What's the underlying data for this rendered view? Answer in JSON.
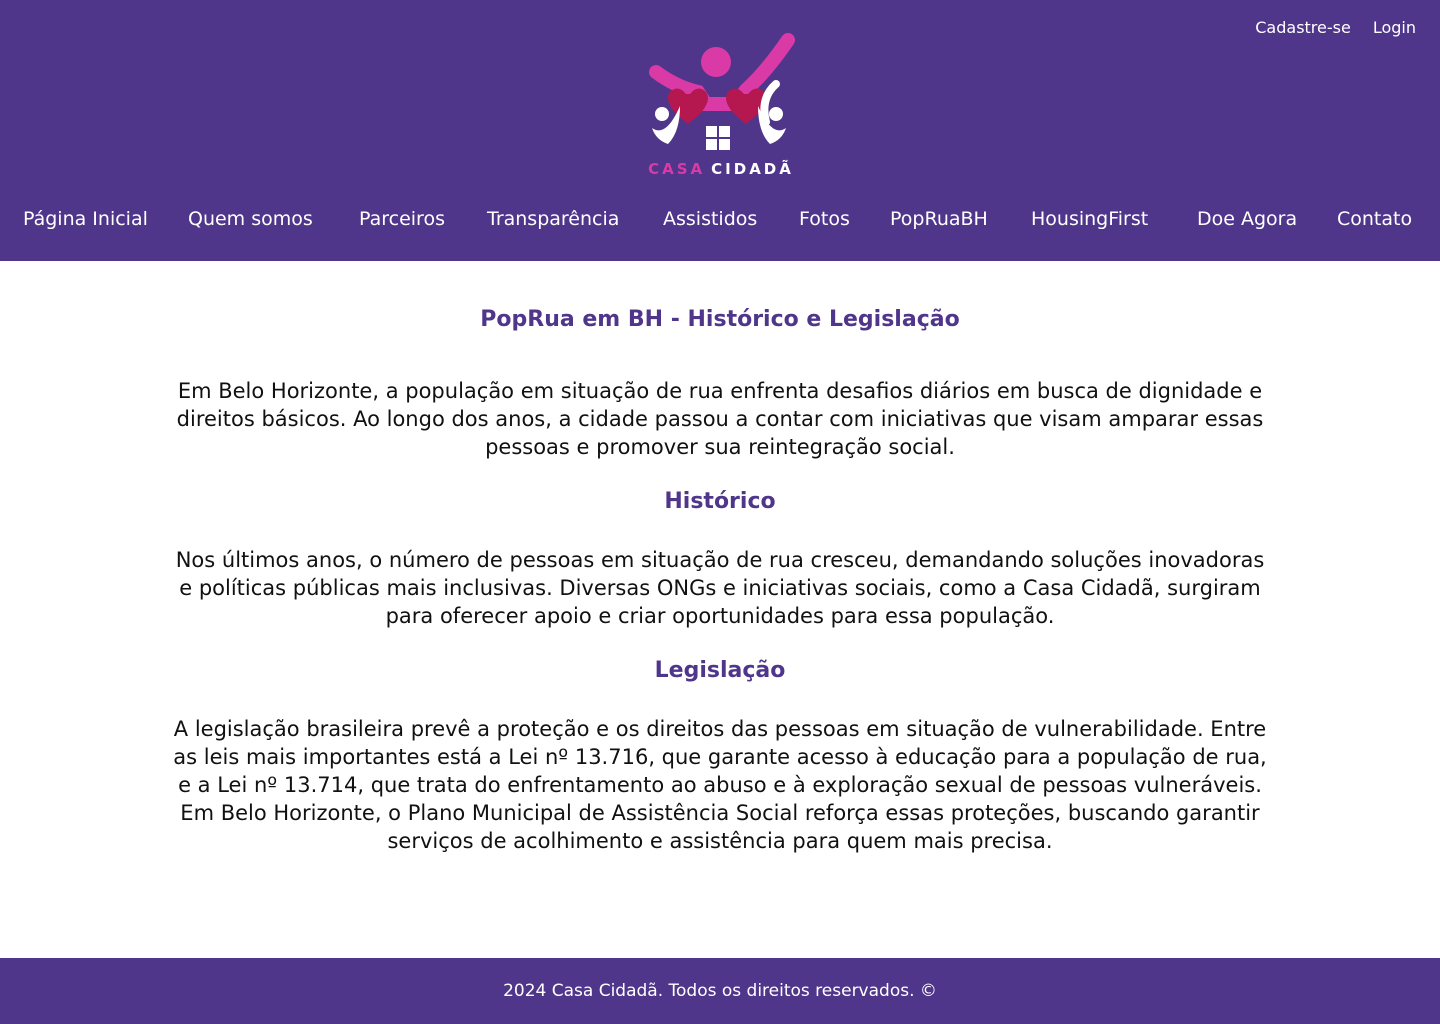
{
  "header": {
    "auth": {
      "signup_label": "Cadastre-se",
      "login_label": "Login"
    },
    "logo": {
      "word1": "CASA",
      "word2": "CIDADÃ"
    },
    "nav": [
      {
        "label": "Página Inicial"
      },
      {
        "label": "Quem somos"
      },
      {
        "label": "Parceiros"
      },
      {
        "label": "Transparência"
      },
      {
        "label": "Assistidos"
      },
      {
        "label": "Fotos"
      },
      {
        "label": "PopRuaBH"
      },
      {
        "label": "HousingFirst"
      },
      {
        "label": "Doe Agora"
      },
      {
        "label": "Contato"
      }
    ]
  },
  "main": {
    "title": "PopRua em BH - Histórico e Legislação",
    "intro": "Em Belo Horizonte, a população em situação de rua enfrenta desafios diários em busca de dignidade e direitos básicos. Ao longo dos anos, a cidade passou a contar com iniciativas que visam amparar essas pessoas e promover sua reintegração social.",
    "historico": {
      "title": "Histórico",
      "text": "Nos últimos anos, o número de pessoas em situação de rua cresceu, demandando soluções inovadoras e políticas públicas mais inclusivas. Diversas ONGs e iniciativas sociais, como a Casa Cidadã, surgiram para oferecer apoio e criar oportunidades para essa população."
    },
    "legislacao": {
      "title": "Legislação",
      "text": "A legislação brasileira prevê a proteção e os direitos das pessoas em situação de vulnerabilidade. Entre as leis mais importantes está a Lei nº 13.716, que garante acesso à educação para a população de rua, e a Lei nº 13.714, que trata do enfrentamento ao abuso e à exploração sexual de pessoas vulneráveis. Em Belo Horizonte, o Plano Municipal de Assistência Social reforça essas proteções, buscando garantir serviços de acolhimento e assistência para quem mais precisa."
    }
  },
  "footer": {
    "text": "2024 Casa Cidadã. Todos os direitos reservados. ©"
  },
  "colors": {
    "primary": "#4f368b",
    "accent": "#d93aa6",
    "heart": "#b5174f"
  }
}
